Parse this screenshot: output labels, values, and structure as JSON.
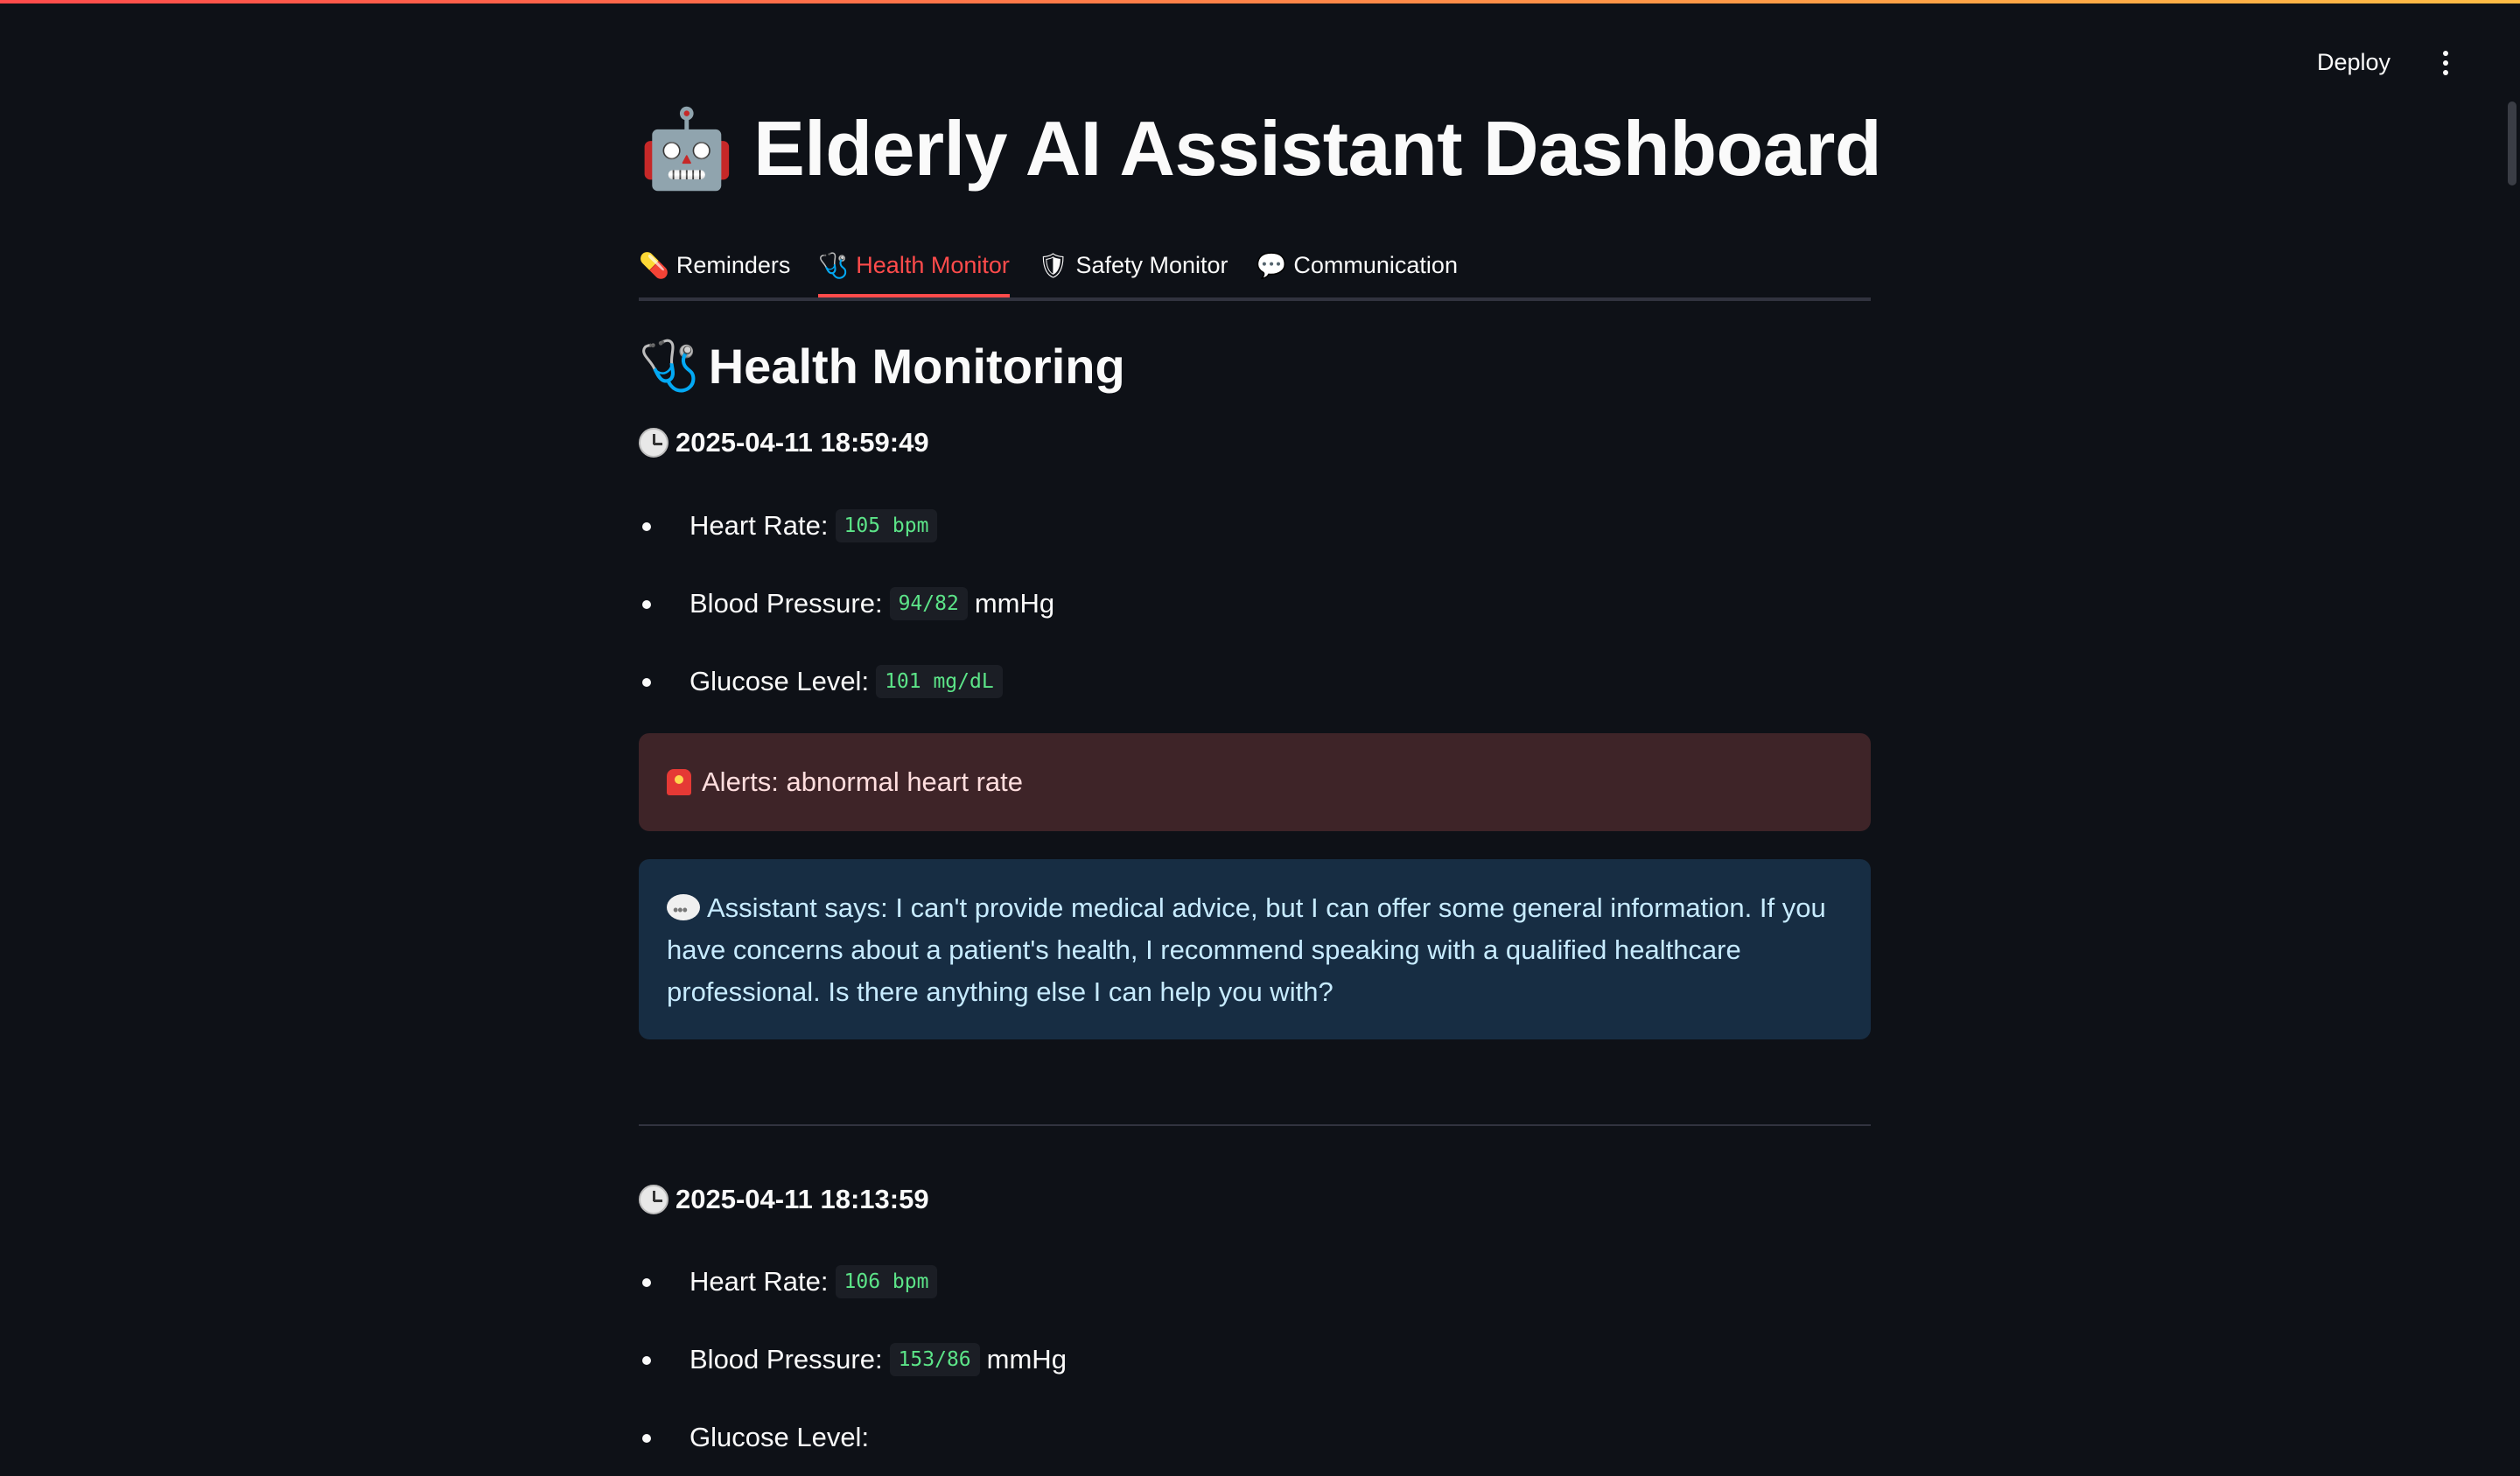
{
  "app": {
    "deploy_label": "Deploy",
    "title": "Elderly AI Assistant Dashboard",
    "title_icon": "robot-icon"
  },
  "tabs": [
    {
      "label": "Reminders",
      "icon": "pill-icon",
      "active": false
    },
    {
      "label": "Health Monitor",
      "icon": "stethoscope-icon",
      "active": true
    },
    {
      "label": "Safety Monitor",
      "icon": "shield-icon",
      "active": false
    },
    {
      "label": "Communication",
      "icon": "speech-bubble-icon",
      "active": false
    }
  ],
  "section": {
    "heading": "Health Monitoring",
    "heading_icon": "stethoscope-icon"
  },
  "entries": [
    {
      "timestamp": "2025-04-11 18:59:49",
      "heart_rate_label": "Heart Rate:",
      "heart_rate": "105 bpm",
      "bp_label": "Blood Pressure:",
      "bp": "94/82",
      "bp_unit": "mmHg",
      "glucose_label": "Glucose Level:",
      "glucose": "101 mg/dL",
      "alert": "Alerts: abnormal heart rate",
      "assistant": "Assistant says: I can't provide medical advice, but I can offer some general information. If you have concerns about a patient's health, I recommend speaking with a qualified healthcare professional. Is there anything else I can help you with?"
    },
    {
      "timestamp": "2025-04-11 18:13:59",
      "heart_rate_label": "Heart Rate:",
      "heart_rate": "106 bpm",
      "bp_label": "Blood Pressure:",
      "bp": "153/86",
      "bp_unit": "mmHg",
      "glucose_label": "Glucose Level:"
    }
  ],
  "colors": {
    "background": "#0e1117",
    "accent": "#ff4b4b",
    "code_text": "#5ce488",
    "error_bg": "#3e2428",
    "info_bg": "#172d43"
  }
}
